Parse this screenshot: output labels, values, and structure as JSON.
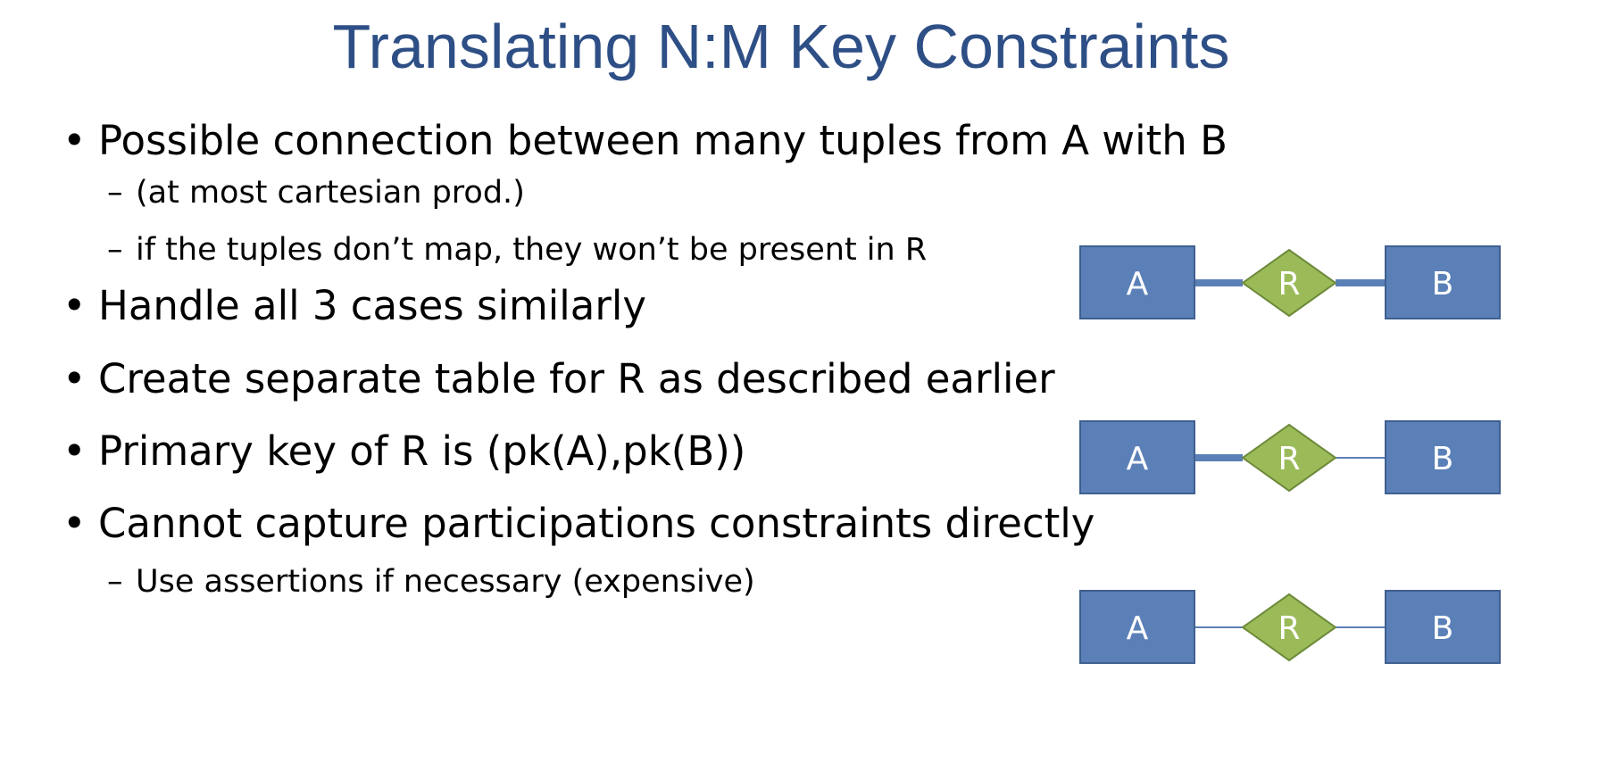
{
  "slide": {
    "title": "Translating N:M Key Constraints",
    "bullets": [
      {
        "level": 1,
        "marker": "•",
        "text": "Possible connection between many tuples from A with B"
      },
      {
        "level": 2,
        "marker": "–",
        "text": "(at most cartesian prod.)"
      },
      {
        "level": 2,
        "marker": "–",
        "text": "if the tuples don’t map, they won’t be present in R"
      },
      {
        "level": 1,
        "marker": "•",
        "text": "Handle all 3 cases similarly"
      },
      {
        "level": 1,
        "marker": "•",
        "text": "Create separate table for R as described earlier"
      },
      {
        "level": 1,
        "marker": "•",
        "text": "Primary key of R is (pk(A),pk(B))"
      },
      {
        "level": 1,
        "marker": "•",
        "text": "Cannot capture participations constraints directly"
      },
      {
        "level": 2,
        "marker": "–",
        "text": "Use assertions if necessary (expensive)"
      }
    ]
  },
  "diagrams": [
    {
      "entity_left": "A",
      "relationship": "R",
      "entity_right": "B",
      "left_line": "thick",
      "right_line": "thick"
    },
    {
      "entity_left": "A",
      "relationship": "R",
      "entity_right": "B",
      "left_line": "thick",
      "right_line": "thin"
    },
    {
      "entity_left": "A",
      "relationship": "R",
      "entity_right": "B",
      "left_line": "thin",
      "right_line": "thin"
    }
  ],
  "colors": {
    "title": "#2e4f86",
    "entity_fill": "#5b80b8",
    "entity_stroke": "#3f5f8f",
    "relationship_fill": "#9bbb59",
    "relationship_stroke": "#6d8a3a",
    "connector": "#5b80b8"
  }
}
